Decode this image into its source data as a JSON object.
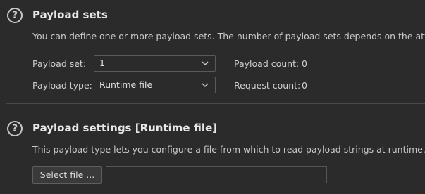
{
  "payload_sets": {
    "help_icon": "question-circle-icon",
    "help_glyph": "?",
    "title": "Payload sets",
    "description": "You can define one or more payload sets. The number of payload sets depends on the attac",
    "payload_set_label": "Payload set:",
    "payload_set_value": "1",
    "payload_type_label": "Payload type:",
    "payload_type_value": "Runtime file",
    "payload_count_label": "Payload count:",
    "payload_count_value": "0",
    "request_count_label": "Request count:",
    "request_count_value": "0"
  },
  "payload_settings": {
    "help_icon": "question-circle-icon",
    "help_glyph": "?",
    "title": "Payload settings [Runtime file]",
    "description": "This payload type lets you configure a file from which to read payload strings at runtime.",
    "select_file_label": "Select file ...",
    "file_path_value": ""
  },
  "colors": {
    "background": "#2b2b2b",
    "text": "#d9d9d9",
    "border": "#5a5a5a"
  }
}
